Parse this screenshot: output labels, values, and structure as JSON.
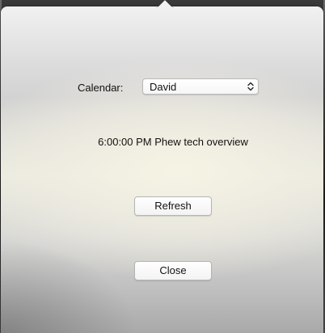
{
  "calendar": {
    "label": "Calendar:",
    "selected": "David",
    "chevron_icon": "up-down-chevron-icon"
  },
  "event": {
    "text": "6:00:00 PM Phew tech overview"
  },
  "buttons": {
    "refresh_label": "Refresh",
    "close_label": "Close"
  },
  "colors": {
    "text": "#111111",
    "button_border": "#b5b5b5",
    "button_bg": "#ffffff"
  }
}
